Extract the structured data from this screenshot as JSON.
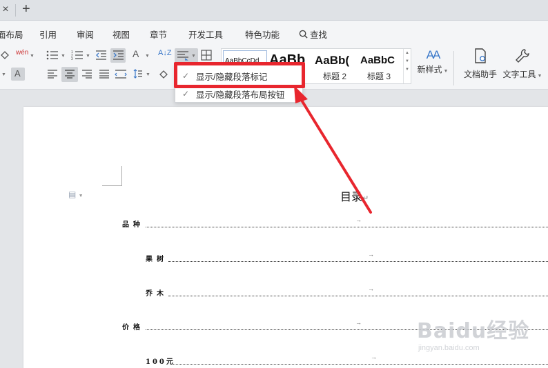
{
  "tabbar": {
    "close_glyph": "×",
    "new_tab_glyph": "+"
  },
  "menu": {
    "items": [
      {
        "label": "面布局"
      },
      {
        "label": "引用"
      },
      {
        "label": "审阅"
      },
      {
        "label": "视图"
      },
      {
        "label": "章节"
      },
      {
        "label": "开发工具"
      },
      {
        "label": "特色功能"
      }
    ],
    "search_label": "查找"
  },
  "toolbar": {
    "font_color_glyph": "A",
    "phonetic_glyph": "wén",
    "char_border_glyph": "A",
    "font_size_glyph": "A",
    "sort_glyph": "A↓Z"
  },
  "styles": {
    "swatches": [
      {
        "preview": "AaBbCcDd",
        "label": ""
      },
      {
        "preview": "AaBb",
        "label": ""
      },
      {
        "preview": "AaBb(",
        "label": "标题 2"
      },
      {
        "preview": "AaBbC",
        "label": "标题 3"
      }
    ],
    "new_style_label": "新样式",
    "new_style_glyph": "AA"
  },
  "right_tools": {
    "doc_helper_label": "文档助手",
    "text_tools_label": "文字工具"
  },
  "dropdown": {
    "items": [
      {
        "label": "显示/隐藏段落标记",
        "checked": true
      },
      {
        "label": "显示/隐藏段落布局按钮",
        "checked": true
      }
    ]
  },
  "document": {
    "toc_title": "目录",
    "paragraph_mark": "↵",
    "tab_arrow": "→",
    "entries": [
      {
        "label": "品种",
        "level": 1
      },
      {
        "label": "果树",
        "level": 2
      },
      {
        "label": "乔木",
        "level": 2
      },
      {
        "label": "价格",
        "level": 1
      },
      {
        "label": "100元",
        "level": 2
      }
    ]
  },
  "watermark": {
    "main": "Baidu经验",
    "sub": "jingyan.baidu.com"
  },
  "colors": {
    "annotation_red": "#e8262e",
    "ribbon_bg": "#f4f5f7",
    "doc_bg": "#e3e5e8"
  }
}
